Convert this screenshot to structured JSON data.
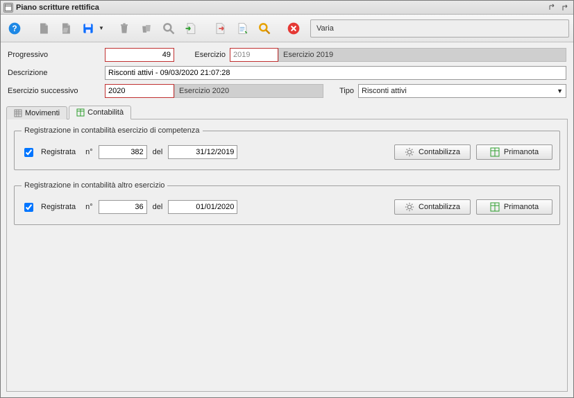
{
  "window": {
    "title": "Piano scritture rettifica"
  },
  "toolbar": {
    "varia_label": "Varia"
  },
  "form": {
    "progressivo_label": "Progressivo",
    "progressivo_value": "49",
    "esercizio_label": "Esercizio",
    "esercizio_value": "2019",
    "esercizio_text": "Esercizio 2019",
    "descrizione_label": "Descrizione",
    "descrizione_value": "Risconti attivi - 09/03/2020 21:07:28",
    "esercizio_succ_label": "Esercizio successivo",
    "esercizio_succ_value": "2020",
    "esercizio_succ_text": "Esercizio 2020",
    "tipo_label": "Tipo",
    "tipo_value": "Risconti attivi"
  },
  "tabs": {
    "movimenti": "Movimenti",
    "contabilita": "Contabilità"
  },
  "group1": {
    "legend": "Registrazione in contabilità esercizio di competenza",
    "registrata_label": "Registrata",
    "n_label": "n°",
    "n_value": "382",
    "del_label": "del",
    "date_value": "31/12/2019",
    "contabilizza": "Contabilizza",
    "primanota": "Primanota"
  },
  "group2": {
    "legend": "Registrazione in contabilità altro esercizio",
    "registrata_label": "Registrata",
    "n_label": "n°",
    "n_value": "36",
    "del_label": "del",
    "date_value": "01/01/2020",
    "contabilizza": "Contabilizza",
    "primanota": "Primanota"
  }
}
